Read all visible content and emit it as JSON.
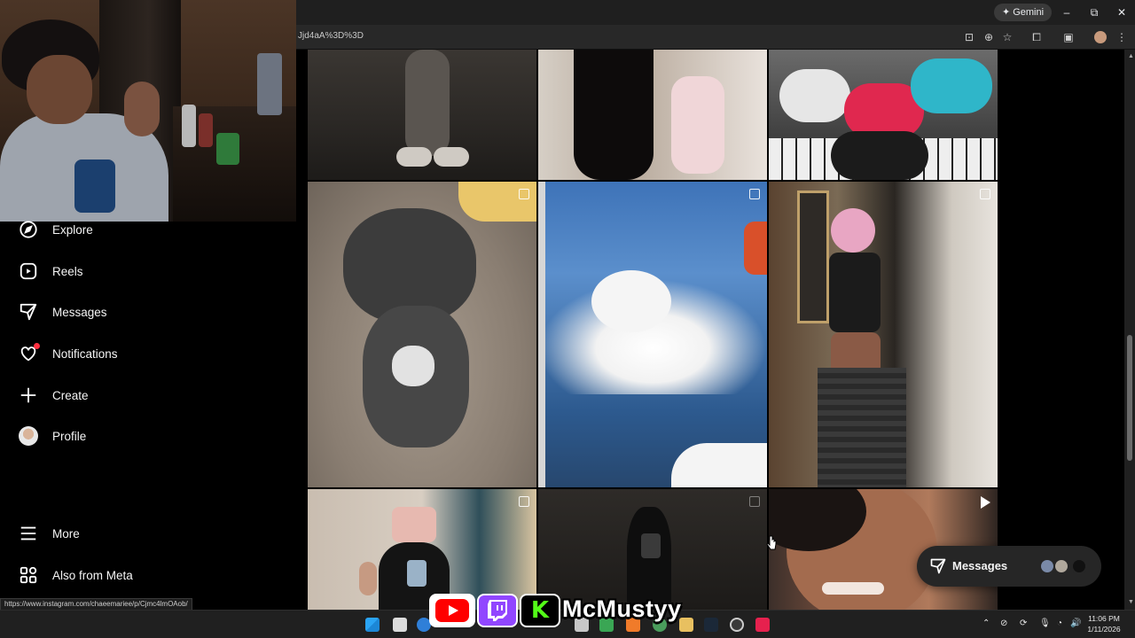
{
  "browser": {
    "gemini_label": "Gemini",
    "address_text": "Jjd4aA%3D%3D",
    "status_url": "https://www.instagram.com/chaeemariee/p/Cjmc4lmOAob/"
  },
  "sidebar": {
    "items": [
      {
        "label": "Explore",
        "icon": "compass-icon"
      },
      {
        "label": "Reels",
        "icon": "reels-icon"
      },
      {
        "label": "Messages",
        "icon": "messenger-icon"
      },
      {
        "label": "Notifications",
        "icon": "heart-icon"
      },
      {
        "label": "Create",
        "icon": "plus-icon"
      },
      {
        "label": "Profile",
        "icon": "profile-avatar"
      },
      {
        "label": "More",
        "icon": "menu-icon"
      },
      {
        "label": "Also from Meta",
        "icon": "meta-apps-icon"
      }
    ]
  },
  "feed": {
    "tiles": [
      {
        "subject": "legs-fluffy-slippers"
      },
      {
        "subject": "long-black-hair-pink-top"
      },
      {
        "subject": "game-controllers-keyboard"
      },
      {
        "subject": "grey-terrier-dog",
        "multi": true
      },
      {
        "subject": "airplane-window-clouds",
        "multi": true
      },
      {
        "subject": "mirror-selfie-hallway",
        "multi": true
      },
      {
        "subject": "peace-sign-mirror-selfie",
        "multi": true
      },
      {
        "subject": "dark-mirror-selfie",
        "multi": true
      },
      {
        "subject": "close-up-smile",
        "reel": true
      }
    ]
  },
  "messages_pill": {
    "label": "Messages"
  },
  "overlay": {
    "channel_name": "McMustyy"
  },
  "taskbar": {
    "time": "11:06 PM",
    "date": "1/11/2026"
  },
  "colors": {
    "accent_red": "#ff3040",
    "youtube_red": "#ff0000",
    "twitch_purple": "#9146ff",
    "kick_green": "#53fc18"
  }
}
